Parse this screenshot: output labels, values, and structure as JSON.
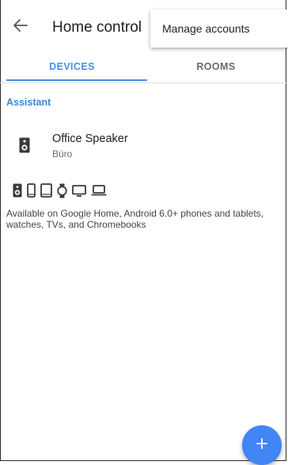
{
  "app": {
    "title": "Home control"
  },
  "tabs": [
    {
      "label": "DEVICES",
      "active": true
    },
    {
      "label": "ROOMS",
      "active": false
    }
  ],
  "section": {
    "label": "Assistant"
  },
  "device": {
    "name": "Office Speaker",
    "room": "Büro",
    "icon": "speaker-icon"
  },
  "availability": {
    "icons": [
      "speaker-icon",
      "phone-icon",
      "tablet-icon",
      "watch-icon",
      "tv-icon",
      "laptop-icon"
    ],
    "text": "Available on Google Home, Android 6.0+ phones and tablets, watches, TVs, and Chromebooks"
  },
  "menu": {
    "items": [
      {
        "label": "Manage accounts"
      }
    ]
  },
  "fab": {
    "icon": "plus-icon"
  },
  "colors": {
    "accent": "#4a90e2",
    "fab": "#4285f4",
    "text": "#212121"
  }
}
